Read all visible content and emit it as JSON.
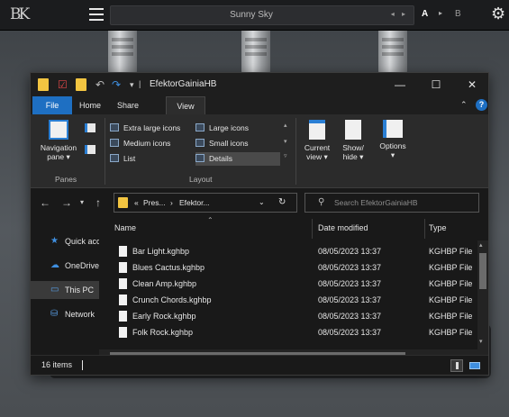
{
  "host": {
    "preset_name": "Sunny Sky",
    "preset_arrows": "◂ ▸",
    "ab_a": "A",
    "ab_arrow": "▸",
    "ab_b": "B",
    "logo_text": "BK"
  },
  "explorer": {
    "title": "EfektorGainiaHB",
    "window_buttons": {
      "minimize": "—",
      "maximize": "☐",
      "close": "✕"
    },
    "tabs": [
      "File",
      "Home",
      "Share",
      "View"
    ],
    "active_tab": "View",
    "ribbon": {
      "navigation_pane": "Navigation",
      "navigation_pane_2": "pane ▾",
      "panes_group": "Panes",
      "layout_group": "Layout",
      "layout_items": [
        "Extra large icons",
        "Large icons",
        "Medium icons",
        "Small icons",
        "List",
        "Details"
      ],
      "selected_layout": "Details",
      "current_view_1": "Current",
      "current_view_2": "view ▾",
      "show_hide_1": "Show/",
      "show_hide_2": "hide ▾",
      "options": "Options",
      "options_arrow": "▾"
    },
    "address": {
      "crumb_prefix": "«",
      "crumb_1": "Pres...",
      "crumb_sep": "›",
      "crumb_2": "Efektor...",
      "search_placeholder": "Search EfektorGainiaHB"
    },
    "nav_pane": [
      {
        "icon": "star-icon",
        "label": "Quick acce"
      },
      {
        "icon": "cloud-icon",
        "label": "OneDrive"
      },
      {
        "icon": "computer-icon",
        "label": "This PC"
      },
      {
        "icon": "network-icon",
        "label": "Network"
      }
    ],
    "columns": [
      "Name",
      "Date modified",
      "Type"
    ],
    "files": [
      {
        "name": "Bar Light.kghbp",
        "date": "08/05/2023 13:37",
        "type": "KGHBP File"
      },
      {
        "name": "Blues Cactus.kghbp",
        "date": "08/05/2023 13:37",
        "type": "KGHBP File"
      },
      {
        "name": "Clean Amp.kghbp",
        "date": "08/05/2023 13:37",
        "type": "KGHBP File"
      },
      {
        "name": "Crunch Chords.kghbp",
        "date": "08/05/2023 13:37",
        "type": "KGHBP File"
      },
      {
        "name": "Early Rock.kghbp",
        "date": "08/05/2023 13:37",
        "type": "KGHBP File"
      },
      {
        "name": "Folk Rock.kghbp",
        "date": "08/05/2023 13:37",
        "type": "KGHBP File"
      }
    ],
    "status": {
      "item_count": "16 items"
    }
  }
}
